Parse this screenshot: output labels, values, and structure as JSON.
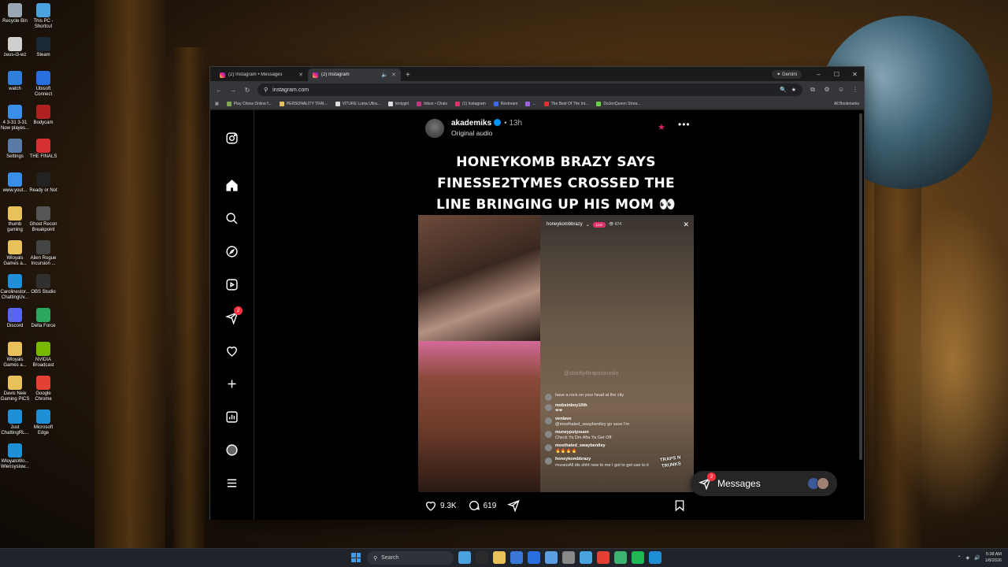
{
  "desktop": {
    "icons": [
      {
        "label": "Recycle Bin",
        "color": "#9aa6b4"
      },
      {
        "label": "This PC - Shortcut",
        "color": "#4aa3df"
      },
      {
        "label": "zeus-i3-wz",
        "color": "#cfcfcf"
      },
      {
        "label": "Steam",
        "color": "#1b2838"
      },
      {
        "label": "watch",
        "color": "#2f7fd8"
      },
      {
        "label": "Ubisoft Connect",
        "color": "#2a6fe0"
      },
      {
        "label": "4 3-31 3-31 Now playes...",
        "color": "#3a8ee8"
      },
      {
        "label": "Bodycam",
        "color": "#b02020"
      },
      {
        "label": "Settings",
        "color": "#5a7aa8"
      },
      {
        "label": "THE FINALS",
        "color": "#d83030"
      },
      {
        "label": "www.yout...",
        "color": "#3a8ee8"
      },
      {
        "label": "Ready or Not",
        "color": "#222"
      },
      {
        "label": "thumb gaming",
        "color": "#e8c15a"
      },
      {
        "label": "Ghost Recon Breakpoint",
        "color": "#555"
      },
      {
        "label": "Wloyals Games a...",
        "color": "#e8c15a"
      },
      {
        "label": "Alien Rogue Incursion ...",
        "color": "#444"
      },
      {
        "label": "Carolinestor... ChattingUv...",
        "color": "#1f8fd8"
      },
      {
        "label": "OBS Studio",
        "color": "#303030"
      },
      {
        "label": "Discord",
        "color": "#5865f2"
      },
      {
        "label": "Delta Force",
        "color": "#2aa860"
      },
      {
        "label": "Wloyals Games a...",
        "color": "#e8c15a"
      },
      {
        "label": "NVIDIA Broadcast",
        "color": "#76b900"
      },
      {
        "label": "Davis New Gaming PICS",
        "color": "#e8c15a"
      },
      {
        "label": "Google Chrome",
        "color": "#e34133"
      },
      {
        "label": "Just ChattingRL...",
        "color": "#1f8fd8"
      },
      {
        "label": "Microsoft Edge",
        "color": "#1f8fd8"
      },
      {
        "label": "WloyalsWo... Wlensyslow...",
        "color": "#1f8fd8"
      }
    ]
  },
  "browser": {
    "tabs": [
      {
        "title": "(2) Instagram • Messages",
        "active": false
      },
      {
        "title": "(2) Instagram",
        "active": true
      }
    ],
    "gemini_label": "Gemini",
    "url": "instagram.com",
    "bookmarks": [
      {
        "label": "Play Chess Online f...",
        "color": "#7fa650"
      },
      {
        "label": "PERSONALITY TRAI...",
        "color": "#e8c15a"
      },
      {
        "label": "VITURE Luma Ultra...",
        "color": "#ddd"
      },
      {
        "label": "lentygirl",
        "color": "#ddd"
      },
      {
        "label": "Inbox • Chats",
        "color": "#c13584"
      },
      {
        "label": "(1) Instagram",
        "color": "#e1306c"
      },
      {
        "label": "Restream",
        "color": "#3a6af0"
      },
      {
        "label": "...",
        "color": "#a060e0"
      },
      {
        "label": "The Best Of The Int...",
        "color": "#e03030"
      },
      {
        "label": "DoJenQueen Strea...",
        "color": "#6ad040"
      }
    ],
    "all_bookmarks_label": "All Bookmarks"
  },
  "instagram": {
    "nav": [
      {
        "name": "instagram-logo-icon",
        "label": "Instagram"
      },
      {
        "name": "home-icon",
        "label": "Home"
      },
      {
        "name": "search-icon",
        "label": "Search"
      },
      {
        "name": "explore-icon",
        "label": "Explore"
      },
      {
        "name": "reels-icon",
        "label": "Reels"
      },
      {
        "name": "messages-icon",
        "label": "Messages",
        "badge": "2"
      },
      {
        "name": "notifications-icon",
        "label": "Notifications"
      },
      {
        "name": "create-icon",
        "label": "Create"
      },
      {
        "name": "dashboard-icon",
        "label": "Dashboard"
      },
      {
        "name": "profile-icon",
        "label": "Profile"
      },
      {
        "name": "more-menu-icon",
        "label": "More"
      }
    ],
    "post": {
      "username": "akademiks",
      "time_ago": "13h",
      "audio": "Original audio",
      "headline_lines": [
        "HONEYKOMB BRAZY SAYS",
        "FINESSE2TYMES CROSSED THE",
        "LINE BRINGING UP HIS MOM 👀"
      ],
      "live": {
        "host": "honeykombbrazy",
        "live_label": "Live",
        "viewers": "674",
        "watermark": "@strictly4trapsntrunks",
        "comments": [
          {
            "user": "",
            "text": "have a rock on your head at the city"
          },
          {
            "user": "mobsinboy10th",
            "text": "❤❤"
          },
          {
            "user": "venlavo",
            "text": "@mosthated_swaybentley go save I'm"
          },
          {
            "user": "muneyputyouon",
            "text": "Check Ya Dm Afta Ya Get Off"
          },
          {
            "user": "mosthated_swaybentley",
            "text": "🔥🔥🔥🔥"
          },
          {
            "user": "honeykombbrazy",
            "text": "All dis shht new to me I got to get use to it",
            "pinned": "PINNED"
          }
        ],
        "brand": "TRAPS N TRUNKS"
      },
      "likes": "9.3K",
      "comments_count": "619"
    },
    "messages_pill": {
      "label": "Messages",
      "badge": "2"
    }
  },
  "taskbar": {
    "search_placeholder": "Search",
    "clock_time": "5:38 AM",
    "clock_date": "1/8/2026",
    "apps": [
      "#4aa3df",
      "#2a2a2a",
      "#e8c15a",
      "#3a78d8",
      "#2a6fe0",
      "#5aa0e0",
      "#888",
      "#4aa3df",
      "#e34133",
      "#3cb371",
      "#1db954",
      "#1f8fd8"
    ]
  }
}
